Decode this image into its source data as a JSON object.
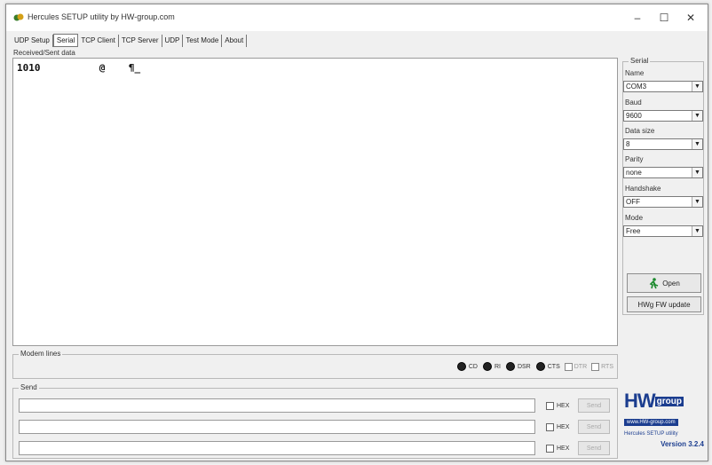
{
  "window": {
    "title": "Hercules SETUP utility by HW-group.com",
    "minimize": "–",
    "maximize": "☐",
    "close": "✕"
  },
  "tabs": [
    {
      "label": "UDP Setup"
    },
    {
      "label": "Serial",
      "active": true
    },
    {
      "label": "TCP Client"
    },
    {
      "label": "TCP Server"
    },
    {
      "label": "UDP"
    },
    {
      "label": "Test Mode"
    },
    {
      "label": "About"
    }
  ],
  "received": {
    "label": "Received/Sent data",
    "content": "1010          @    ¶_"
  },
  "serial": {
    "group_title": "Serial",
    "name_label": "Name",
    "name_value": "COM3",
    "baud_label": "Baud",
    "baud_value": "9600",
    "datasize_label": "Data size",
    "datasize_value": "8",
    "parity_label": "Parity",
    "parity_value": "none",
    "handshake_label": "Handshake",
    "handshake_value": "OFF",
    "mode_label": "Mode",
    "mode_value": "Free",
    "open_button": "Open",
    "update_button": "HWg FW update"
  },
  "modem": {
    "group_title": "Modem lines",
    "leds": [
      "CD",
      "RI",
      "DSR",
      "CTS"
    ],
    "checks": [
      "DTR",
      "RTS"
    ]
  },
  "send": {
    "group_title": "Send",
    "rows": [
      {
        "hex_label": "HEX",
        "button": "Send"
      },
      {
        "hex_label": "HEX",
        "button": "Send"
      },
      {
        "hex_label": "HEX",
        "button": "Send"
      }
    ]
  },
  "logo": {
    "brand_main": "HW",
    "brand_sub": "group",
    "url": "www.HW-group.com",
    "app_name": "Hercules SETUP utility",
    "version": "Version  3.2.4"
  },
  "colors": {
    "brand": "#1b3d8f",
    "open_icon": "#1c8a2e"
  }
}
